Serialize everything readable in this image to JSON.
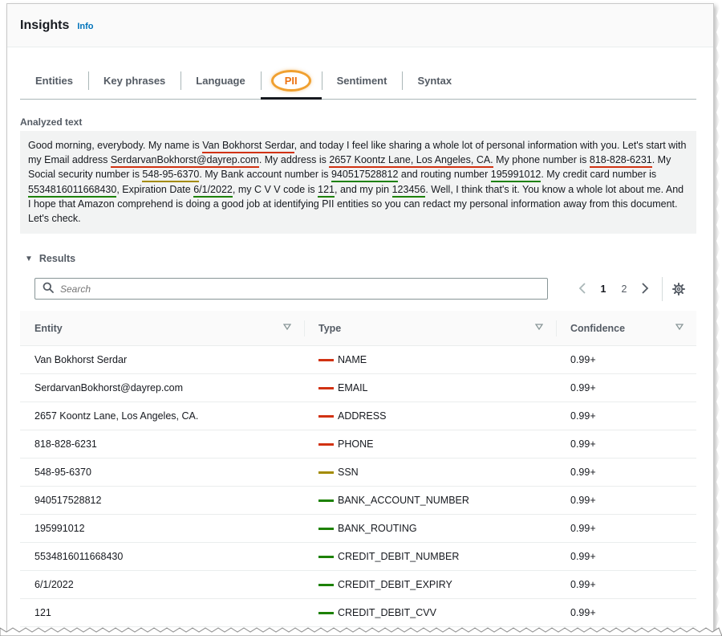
{
  "header": {
    "title": "Insights",
    "info_label": "Info"
  },
  "tabs": [
    {
      "label": "Entities"
    },
    {
      "label": "Key phrases"
    },
    {
      "label": "Language"
    },
    {
      "label": "PII"
    },
    {
      "label": "Sentiment"
    },
    {
      "label": "Syntax"
    }
  ],
  "active_tab": "PII",
  "analyzed": {
    "label": "Analyzed text",
    "segments": [
      {
        "text": "Good morning, everybody. My name is "
      },
      {
        "text": "Van Bokhorst Serdar",
        "color": "red"
      },
      {
        "text": ", and today I feel like sharing a whole lot of personal information with you. Let's start with my Email address "
      },
      {
        "text": "SerdarvanBokhorst@dayrep.com",
        "color": "red"
      },
      {
        "text": ". My address is "
      },
      {
        "text": "2657 Koontz Lane, Los Angeles, CA.",
        "color": "red"
      },
      {
        "text": " My phone number is "
      },
      {
        "text": "818-828-6231",
        "color": "red"
      },
      {
        "text": ". My Social security number is "
      },
      {
        "text": "548-95-6370",
        "color": "olive"
      },
      {
        "text": ". My Bank account number is "
      },
      {
        "text": "940517528812",
        "color": "green"
      },
      {
        "text": " and routing number "
      },
      {
        "text": "195991012",
        "color": "green"
      },
      {
        "text": ". My credit card number is "
      },
      {
        "text": "5534816011668430",
        "color": "green"
      },
      {
        "text": ", Expiration Date "
      },
      {
        "text": "6/1/2022",
        "color": "green"
      },
      {
        "text": ", my C V V code is "
      },
      {
        "text": "121",
        "color": "green"
      },
      {
        "text": ", and my pin "
      },
      {
        "text": "123456",
        "color": "green"
      },
      {
        "text": ". Well, I think that's it. You know a whole lot about me. And I hope that Amazon comprehend is doing a good job at identifying PII entities so you can redact my personal information away from this document. Let's check."
      }
    ]
  },
  "results": {
    "label": "Results",
    "search_placeholder": "Search",
    "pages": [
      "1",
      "2"
    ],
    "current_page": "1",
    "columns": [
      "Entity",
      "Type",
      "Confidence"
    ],
    "rows": [
      {
        "entity": "Van Bokhorst Serdar",
        "type": "NAME",
        "color": "red",
        "confidence": "0.99+"
      },
      {
        "entity": "SerdarvanBokhorst@dayrep.com",
        "type": "EMAIL",
        "color": "red",
        "confidence": "0.99+"
      },
      {
        "entity": "2657 Koontz Lane, Los Angeles, CA.",
        "type": "ADDRESS",
        "color": "red",
        "confidence": "0.99+"
      },
      {
        "entity": "818-828-6231",
        "type": "PHONE",
        "color": "red",
        "confidence": "0.99+"
      },
      {
        "entity": "548-95-6370",
        "type": "SSN",
        "color": "olive",
        "confidence": "0.99+"
      },
      {
        "entity": "940517528812",
        "type": "BANK_ACCOUNT_NUMBER",
        "color": "green",
        "confidence": "0.99+"
      },
      {
        "entity": "195991012",
        "type": "BANK_ROUTING",
        "color": "green",
        "confidence": "0.99+"
      },
      {
        "entity": "5534816011668430",
        "type": "CREDIT_DEBIT_NUMBER",
        "color": "green",
        "confidence": "0.99+"
      },
      {
        "entity": "6/1/2022",
        "type": "CREDIT_DEBIT_EXPIRY",
        "color": "green",
        "confidence": "0.99+"
      },
      {
        "entity": "121",
        "type": "CREDIT_DEBIT_CVV",
        "color": "green",
        "confidence": "0.99+"
      }
    ]
  },
  "colors": {
    "red": "#d13212",
    "olive": "#a38b00",
    "green": "#1d8102",
    "accent": "#ec7211",
    "link": "#0073bb"
  }
}
